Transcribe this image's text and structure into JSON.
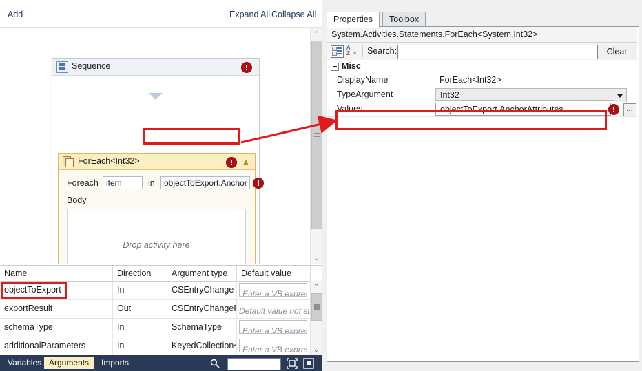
{
  "designer": {
    "toolbar": {
      "add_label": "Add",
      "expand_all_label": "Expand All",
      "collapse_all_label": "Collapse All"
    },
    "sequence": {
      "title": "Sequence",
      "icon": "sequence-icon",
      "error_icon": "error-badge-icon"
    },
    "foreach": {
      "title": "ForEach<Int32>",
      "icon": "foreach-icon",
      "error_icon": "error-badge-icon",
      "collapse_icon": "chevron-up-icon",
      "foreach_label": "Foreach",
      "item_value": "item",
      "in_label": "in",
      "values_expression": "objectToExport.Anchor",
      "expression_error_icon": "error-badge-icon",
      "body_label": "Body",
      "drop_hint": "Drop activity here"
    },
    "scrollbar": {
      "up_glyph": "⌃",
      "down_glyph": "⌄"
    }
  },
  "arguments_grid": {
    "columns": [
      "Name",
      "Direction",
      "Argument type",
      "Default value"
    ],
    "rows": [
      {
        "name": "objectToExport",
        "direction": "In",
        "type": "CSEntryChange",
        "default": "Enter a VB express",
        "default_style": "boxed"
      },
      {
        "name": "exportResult",
        "direction": "Out",
        "type": "CSEntryChangeRes",
        "default": "Default value not su",
        "default_style": "plain"
      },
      {
        "name": "schemaType",
        "direction": "In",
        "type": "SchemaType",
        "default": "Enter a VB express",
        "default_style": "boxed"
      },
      {
        "name": "additionalParameters",
        "direction": "In",
        "type": "KeyedCollection<S",
        "default": "Enter a VB express",
        "default_style": "boxed"
      }
    ],
    "scrollbar": {
      "up_glyph": "⌃",
      "down_glyph": "⌄"
    }
  },
  "bottom_bar": {
    "tabs": [
      {
        "label": "Variables",
        "active": false
      },
      {
        "label": "Arguments",
        "active": true
      },
      {
        "label": "Imports",
        "active": false
      }
    ],
    "search_icon": "search-magnifier-icon",
    "zoom_value": "",
    "zoom_dropdown_icon": "chevron-down-icon",
    "fit_to_screen_icon": "fit-to-screen-icon",
    "overview_icon": "overview-map-icon"
  },
  "properties": {
    "tabs": [
      {
        "label": "Properties",
        "active": true
      },
      {
        "label": "Toolbox",
        "active": false
      }
    ],
    "type_name": "System.Activities.Statements.ForEach<System.Int32>",
    "toolbar": {
      "categorized_icon": "categorized-view-icon",
      "alphabetical_icon": "alphabetical-sort-icon",
      "search_label": "Search:",
      "search_value": "",
      "clear_label": "Clear"
    },
    "group_label": "Misc",
    "rows": [
      {
        "name": "DisplayName",
        "value": "ForEach<Int32>",
        "style": "plain"
      },
      {
        "name": "TypeArgument",
        "value": "Int32",
        "style": "boxed",
        "has_dropdown": true
      },
      {
        "name": "Values",
        "value": "objectToExport.AnchorAttributes",
        "style": "field",
        "has_error": true,
        "has_ellipsis": true,
        "ellipsis_label": "…"
      }
    ]
  },
  "annotations": {
    "highlight_color": "#e01b1b",
    "boxes": [
      {
        "name": "foreach-values-expression-highlight"
      },
      {
        "name": "properties-values-row-highlight"
      },
      {
        "name": "argument-objecttoexport-highlight"
      }
    ],
    "arrow": {
      "name": "values-link-arrow"
    }
  }
}
